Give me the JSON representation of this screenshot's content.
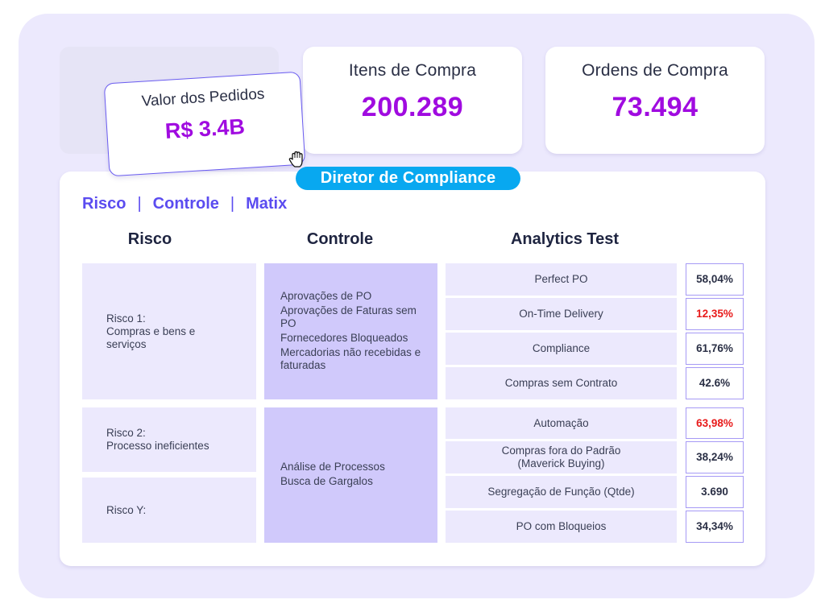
{
  "kpis": {
    "order_value": {
      "label": "Valor dos Pedidos",
      "value": "R$ 3.4B"
    },
    "purchase_items": {
      "label": "Itens de Compra",
      "value": "200.289"
    },
    "purchase_orders": {
      "label": "Ordens de Compra",
      "value": "73.494"
    }
  },
  "role_badge": "Diretor de Compliance",
  "nav": {
    "tabs": [
      "Risco",
      "Controle",
      "Matix"
    ],
    "separator": "|"
  },
  "columns": {
    "risk": "Risco",
    "control": "Controle",
    "analytics": "Analytics Test"
  },
  "risks": [
    {
      "lines": [
        "Risco 1:",
        "Compras e bens e",
        "serviços"
      ]
    },
    {
      "lines": [
        "Risco 2:",
        "Processo ineficientes"
      ]
    },
    {
      "lines": [
        "Risco Y:"
      ]
    }
  ],
  "controls": [
    {
      "items": [
        "Aprovações de PO",
        "Aprovações de Faturas sem PO",
        "Fornecedores Bloqueados",
        "Mercadorias não recebidas e faturadas"
      ]
    },
    {
      "items": [
        "Análise de Processos",
        "Busca de Gargalos"
      ]
    }
  ],
  "tests": [
    {
      "name": "Perfect PO",
      "value": "58,04%",
      "alert": false
    },
    {
      "name": "On-Time Delivery",
      "value": "12,35%",
      "alert": true
    },
    {
      "name": "Compliance",
      "value": "61,76%",
      "alert": false
    },
    {
      "name": "Compras sem Contrato",
      "value": "42.6%",
      "alert": false
    },
    {
      "name": "Automação",
      "value": "63,98%",
      "alert": true
    },
    {
      "name_lines": [
        "Compras fora do Padrão",
        "(Maverick Buying)"
      ],
      "value": "38,24%",
      "alert": false
    },
    {
      "name": "Segregação de Função (Qtde)",
      "value": "3.690",
      "alert": false
    },
    {
      "name": "PO com Bloqueios",
      "value": "34,34%",
      "alert": false
    }
  ],
  "colors": {
    "accent_purple": "#a00be0",
    "nav_blue": "#5b4cf0",
    "badge_blue": "#08a8f0",
    "alert_red": "#e81a1a",
    "risk_bg": "#ece9fd",
    "control_bg": "#d0c9fb"
  }
}
